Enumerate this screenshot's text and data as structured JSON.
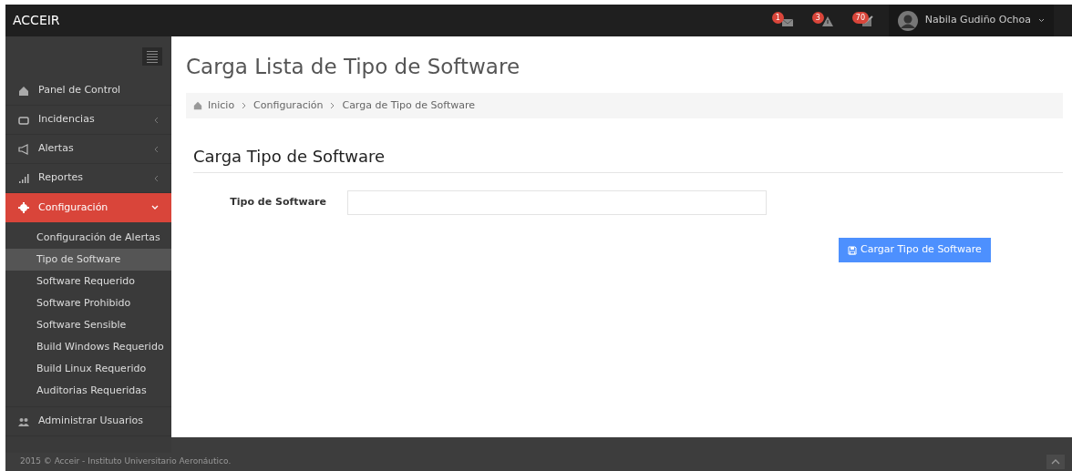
{
  "header": {
    "brand": "ACCEIR",
    "notifications": [
      {
        "kind": "mail",
        "count": "1"
      },
      {
        "kind": "warning",
        "count": "3"
      },
      {
        "kind": "task",
        "count": "70"
      }
    ],
    "user": {
      "name": "Nabila Gudiño Ochoa"
    }
  },
  "sidebar": {
    "items": [
      {
        "label": "Panel de Control",
        "kind": "link",
        "selected": false
      },
      {
        "label": "Incidencias",
        "kind": "group",
        "selected": false,
        "expanded": false
      },
      {
        "label": "Alertas",
        "kind": "group",
        "selected": false,
        "expanded": false
      },
      {
        "label": "Reportes",
        "kind": "group",
        "selected": false,
        "expanded": false
      },
      {
        "label": "Configuración",
        "kind": "group",
        "selected": true,
        "expanded": true,
        "children": [
          {
            "label": "Configuración de Alertas",
            "selected": false
          },
          {
            "label": "Tipo de Software",
            "selected": true
          },
          {
            "label": "Software Requerido",
            "selected": false
          },
          {
            "label": "Software Prohibido",
            "selected": false
          },
          {
            "label": "Software Sensible",
            "selected": false
          },
          {
            "label": "Build Windows Requerido",
            "selected": false
          },
          {
            "label": "Build Linux Requerido",
            "selected": false
          },
          {
            "label": "Auditorias Requeridas",
            "selected": false
          }
        ]
      },
      {
        "label": "Administrar Usuarios",
        "kind": "link",
        "selected": false
      }
    ]
  },
  "page": {
    "title": "Carga Lista de Tipo de Software",
    "breadcrumb": [
      "Inicio",
      "Configuración",
      "Carga de Tipo de Software"
    ],
    "form": {
      "title": "Carga Tipo de Software",
      "field_label": "Tipo de Software",
      "submit": "Cargar Tipo de Software"
    }
  },
  "footer": {
    "text": "2015 © Acceir - Instituto Universitario Aeronáutico."
  }
}
